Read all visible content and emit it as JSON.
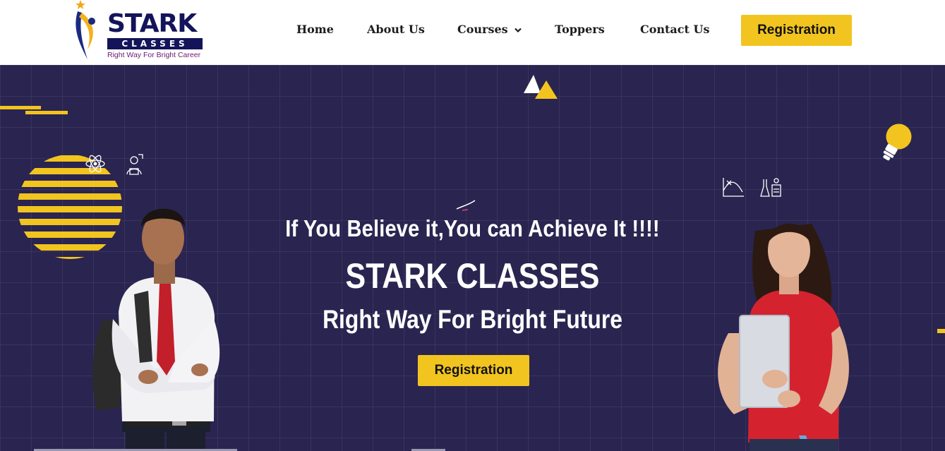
{
  "header": {
    "logo": {
      "name": "STARK",
      "sub": "CLASSES",
      "tagline": "Right Way For Bright Career"
    },
    "nav": {
      "home": "Home",
      "about": "About Us",
      "courses": "Courses",
      "toppers": "Toppers",
      "contact": "Contact Us"
    },
    "registration_label": "Registration"
  },
  "hero": {
    "quote": "If You Believe it,You can Achieve It !!!!",
    "title": "STARK CLASSES",
    "subtitle": "Right Way For Bright Future",
    "registration_label": "Registration"
  },
  "colors": {
    "accent": "#f2c41f",
    "hero_bg": "#2a2450",
    "brand_navy": "#14145a",
    "tagline": "#6a1a6f"
  },
  "icons": [
    "star-icon",
    "chevron-down-icon",
    "atom-icon",
    "scientist-icon",
    "graph-icon",
    "lab-icon",
    "lightbulb-icon",
    "triangle-icon"
  ]
}
